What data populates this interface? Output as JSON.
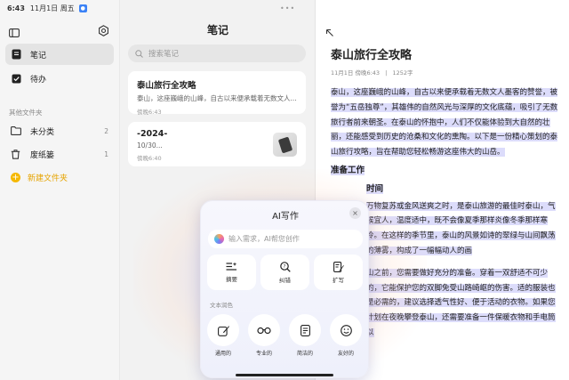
{
  "status": {
    "time": "6:43",
    "date": "11月1日 周五"
  },
  "sidebar": {
    "nav": [
      {
        "label": "笔记"
      },
      {
        "label": "待办"
      }
    ],
    "section_label": "其他文件夹",
    "folders": [
      {
        "label": "未分类",
        "count": "2"
      },
      {
        "label": "废纸篓",
        "count": "1"
      }
    ],
    "new_folder": "新建文件夹"
  },
  "notes_list": {
    "title": "笔记",
    "search_placeholder": "搜索笔记",
    "notes": [
      {
        "title": "泰山旅行全攻略",
        "snippet": "泰山，这座巍峨的山峰，自古以来便承载着无数文人...",
        "date": "傍晚6:43"
      },
      {
        "title": "-2024-",
        "snippet": "10/30...",
        "date": "傍晚6:40"
      }
    ]
  },
  "editor": {
    "title": "泰山旅行全攻略",
    "meta_date": "11月1日 傍晚6:43",
    "meta_sep": "|",
    "meta_count": "1252字",
    "paragraphs": [
      "泰山，这座巍峨的山峰，自古以来便承载着无数文人墨客的赞誉，被誉为“五岳独尊”，其雄伟的自然风光与深厚的文化底蕴，吸引了无数旅行者前来朝圣。在泰山的怀抱中，人们不仅能体验到大自然的壮丽，还能感受到历史的沧桑和文化的熏陶。以下是一份精心策划的泰山旅行攻略，旨在帮助您轻松畅游这座伟大的山岳。"
    ],
    "heading1": "准备工作",
    "heading2": "时间",
    "para2": "万物复苏或金风送爽之时，是泰山旅游的最佳时泰山，气候宜人，温度适中，既不会像夏季那样炎像冬季那样寒冷。在这样的季节里，泰山的风景如诗的翠绿与山间飘荡的薄雾，构成了一幅幅动人的画",
    "para3": "山之前，您需要做好充分的准备。穿着一双舒适不可少的，它能保护您的双脚免受山路崎岖的伤害。适的服装也是必需的，建议选择透气性好、便于活动的衣物。如果您计划在夜晚攀登泰山，还需要准备一件保暖衣物和手电筒以"
  },
  "ai_panel": {
    "title": "AI写作",
    "close": "×",
    "input_placeholder": "输入需求，AI帮您创作",
    "tools": [
      {
        "label": "摘要"
      },
      {
        "label": "纠错"
      },
      {
        "label": "扩写"
      }
    ],
    "section_label": "文本润色",
    "tones": [
      {
        "label": "通用的"
      },
      {
        "label": "专业的"
      },
      {
        "label": "简洁的"
      },
      {
        "label": "友好的"
      }
    ]
  }
}
